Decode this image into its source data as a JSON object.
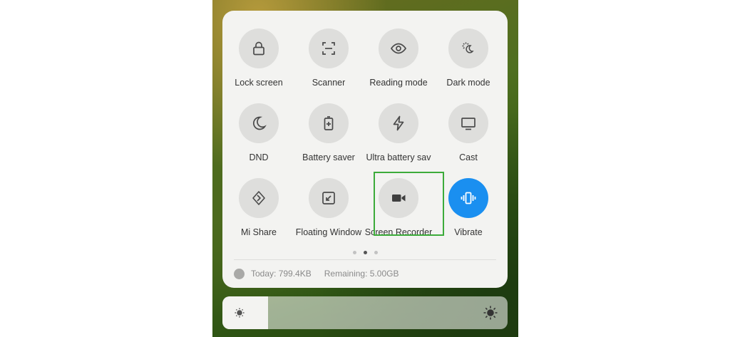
{
  "tiles": [
    {
      "label": "Lock screen",
      "icon": "lock-icon",
      "active": false
    },
    {
      "label": "Scanner",
      "icon": "scanner-icon",
      "active": false
    },
    {
      "label": "Reading mode",
      "icon": "eye-icon",
      "active": false
    },
    {
      "label": "Dark mode",
      "icon": "dark-mode-icon",
      "active": false
    },
    {
      "label": "DND",
      "icon": "moon-icon",
      "active": false
    },
    {
      "label": "Battery saver",
      "icon": "battery-plus-icon",
      "active": false
    },
    {
      "label": "Ultra battery sav",
      "icon": "lightning-icon",
      "active": false
    },
    {
      "label": "Cast",
      "icon": "monitor-icon",
      "active": false
    },
    {
      "label": "Mi Share",
      "icon": "mi-share-icon",
      "active": false
    },
    {
      "label": "Floating Window",
      "icon": "floating-window-icon",
      "active": false
    },
    {
      "label": "Screen Recorder",
      "icon": "video-camera-icon",
      "active": false
    },
    {
      "label": "Vibrate",
      "icon": "vibrate-icon",
      "active": true
    }
  ],
  "page_indicator": {
    "total": 3,
    "current": 2
  },
  "data_usage": {
    "today": "Today: 799.4KB",
    "remaining": "Remaining: 5.00GB"
  },
  "brightness": {
    "level": 0.16
  },
  "colors": {
    "active_tile": "#1a8ff0",
    "inactive_tile": "#dededc",
    "highlight_box": "#3cab3a",
    "panel_bg": "#f3f3f1"
  }
}
